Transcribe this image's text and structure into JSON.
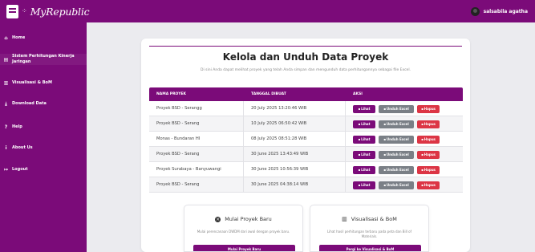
{
  "brand": {
    "name": "MyRepublic"
  },
  "user": {
    "name": "salsabila agatha"
  },
  "sidebar": {
    "items": [
      {
        "label": "Home",
        "icon": "home-icon",
        "glyph": "⌂"
      },
      {
        "label": "Sistem Perhitungan Kinerja Jaringan",
        "icon": "server-icon",
        "glyph": "▤"
      },
      {
        "label": "Visualisasi & BoM",
        "icon": "bar-chart-icon",
        "glyph": "▥"
      },
      {
        "label": "Download Data",
        "icon": "download-icon",
        "glyph": "⤓"
      },
      {
        "label": "Help",
        "icon": "help-icon",
        "glyph": "?"
      },
      {
        "label": "About Us",
        "icon": "info-icon",
        "glyph": "i"
      },
      {
        "label": "Logout",
        "icon": "logout-icon",
        "glyph": "↦"
      }
    ]
  },
  "main": {
    "title": "Kelola dan Unduh Data Proyek",
    "subtitle": "Di sini Anda dapat melihat proyek yang telah Anda simpan dan mengunduh data perhitungannya sebagai file Excel."
  },
  "table": {
    "headers": {
      "name": "NAMA PROYEK",
      "date": "TANGGAL DIBUAT",
      "action": "AKSI"
    },
    "buttons": {
      "view": "Lihat",
      "excel": "Unduh Excel",
      "delete": "Hapus"
    },
    "rows": [
      {
        "name": "Proyek BSD - Serangg",
        "date": "20 July 2025 13:20:46 WIB"
      },
      {
        "name": "Proyek BSD - Serang",
        "date": "10 July 2025 06:50:42 WIB"
      },
      {
        "name": "Monas - Bundaran HI",
        "date": "08 July 2025 08:51:28 WIB"
      },
      {
        "name": "Proyek BSD - Serang",
        "date": "30 June 2025 13:43:49 WIB"
      },
      {
        "name": "Proyek Surabaya - Banyuwangi",
        "date": "30 June 2025 10:56:39 WIB"
      },
      {
        "name": "Proyek BSD - Serang",
        "date": "30 June 2025 04:38:14 WIB"
      }
    ]
  },
  "panels": {
    "new_project": {
      "title": "Mulai Proyek Baru",
      "desc": "Mulai perencanaan DWDM dari awal dengan proyek baru.",
      "button": "Mulai Proyek Baru"
    },
    "visual": {
      "title": "Visualisasi & BoM",
      "desc": "Lihat hasil perhitungan terbaru pada peta dan Bill of Materials.",
      "button": "Pergi ke Visualisasi & BoM"
    }
  },
  "colors": {
    "brand": "#7b0b79",
    "excel": "#7a7f86",
    "delete": "#dc3545"
  }
}
